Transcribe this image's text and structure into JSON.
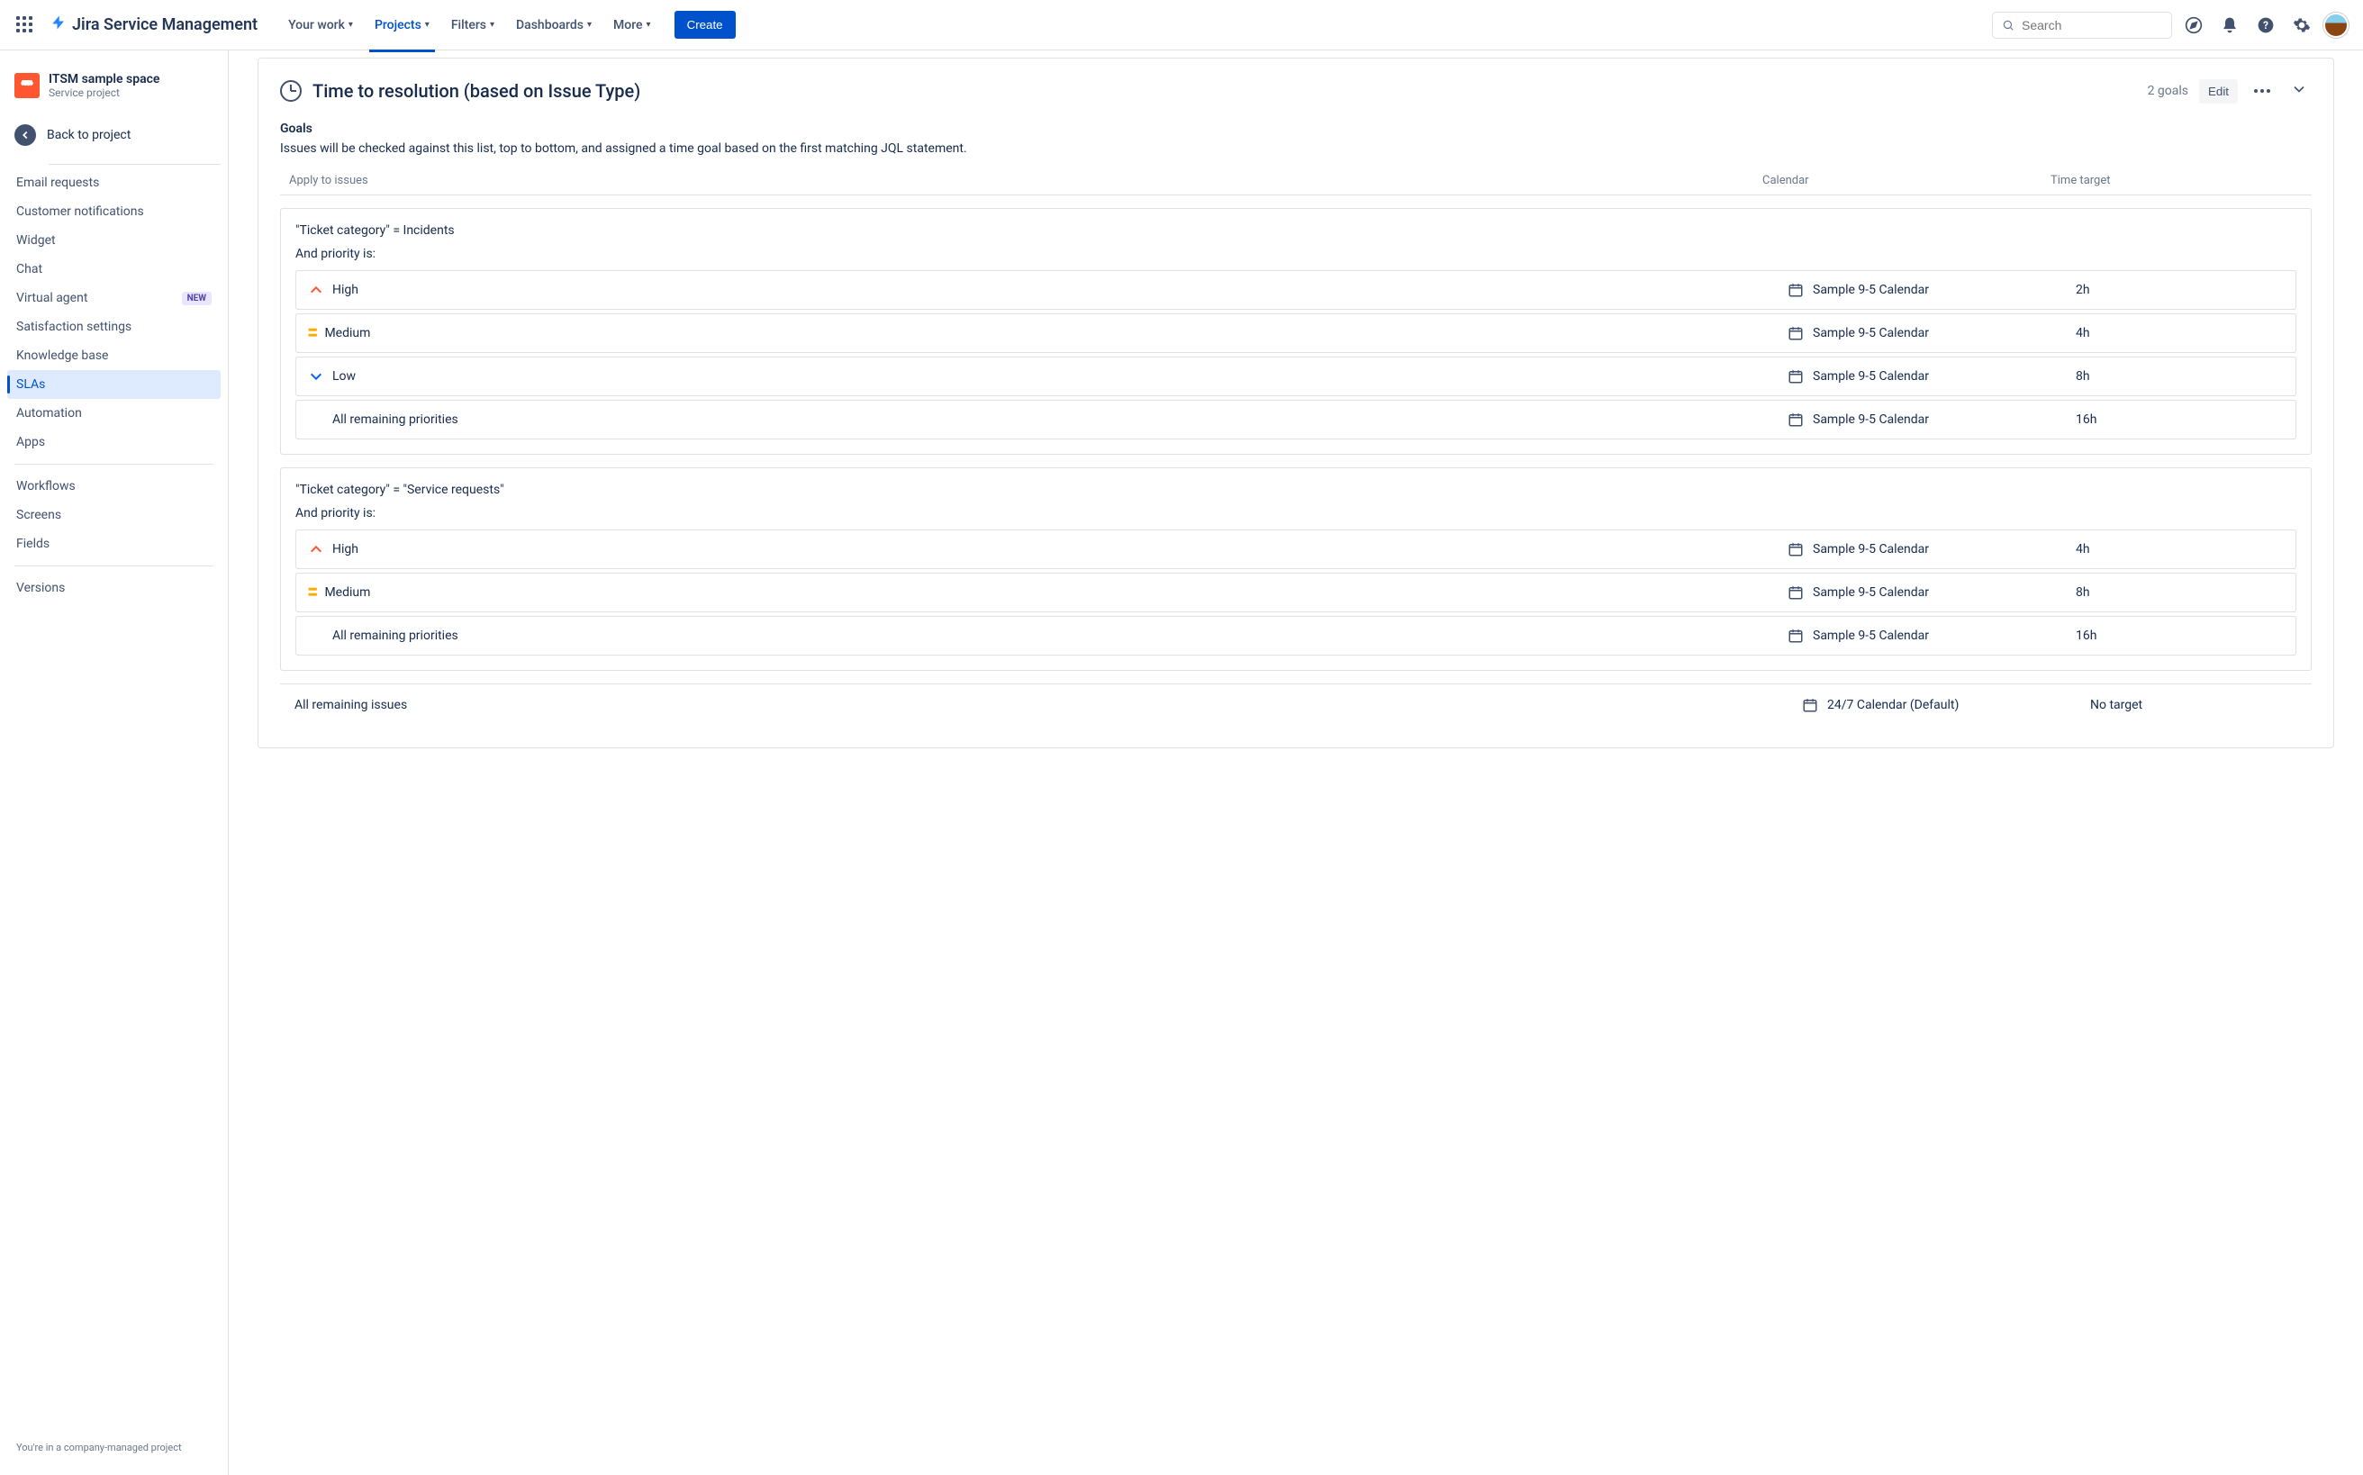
{
  "topnav": {
    "product": "Jira Service Management",
    "items": [
      "Your work",
      "Projects",
      "Filters",
      "Dashboards",
      "More"
    ],
    "active_index": 1,
    "create": "Create",
    "search_placeholder": "Search"
  },
  "sidebar": {
    "project_name": "ITSM sample space",
    "project_type": "Service project",
    "back": "Back to project",
    "items_a": [
      "Email requests",
      "Customer notifications",
      "Widget",
      "Chat",
      "Virtual agent",
      "Satisfaction settings",
      "Knowledge base",
      "SLAs",
      "Automation",
      "Apps"
    ],
    "new_badge_index": 4,
    "selected_index": 7,
    "new_label": "NEW",
    "items_b": [
      "Workflows",
      "Screens",
      "Fields"
    ],
    "items_c": [
      "Versions"
    ],
    "footer": "You're in a company-managed project"
  },
  "sla": {
    "title": "Time to resolution (based on Issue Type)",
    "goals_count": "2 goals",
    "edit": "Edit",
    "section_title": "Goals",
    "section_desc": "Issues will be checked against this list, top to bottom, and assigned a time goal based on the first matching JQL statement.",
    "columns": [
      "Apply to issues",
      "Calendar",
      "Time target"
    ],
    "priority_label": "And priority is:",
    "groups": [
      {
        "jql": "\"Ticket category\" = Incidents",
        "rows": [
          {
            "priority": "High",
            "level": "high",
            "calendar": "Sample 9-5 Calendar",
            "target": "2h"
          },
          {
            "priority": "Medium",
            "level": "medium",
            "calendar": "Sample 9-5 Calendar",
            "target": "4h"
          },
          {
            "priority": "Low",
            "level": "low",
            "calendar": "Sample 9-5 Calendar",
            "target": "8h"
          },
          {
            "priority": "All remaining priorities",
            "level": "none",
            "calendar": "Sample 9-5 Calendar",
            "target": "16h"
          }
        ]
      },
      {
        "jql": "\"Ticket category\" = \"Service requests\"",
        "rows": [
          {
            "priority": "High",
            "level": "high",
            "calendar": "Sample 9-5 Calendar",
            "target": "4h"
          },
          {
            "priority": "Medium",
            "level": "medium",
            "calendar": "Sample 9-5 Calendar",
            "target": "8h"
          },
          {
            "priority": "All remaining priorities",
            "level": "none",
            "calendar": "Sample 9-5 Calendar",
            "target": "16h"
          }
        ]
      }
    ],
    "remaining": {
      "label": "All remaining issues",
      "calendar": "24/7 Calendar (Default)",
      "target": "No target"
    }
  }
}
